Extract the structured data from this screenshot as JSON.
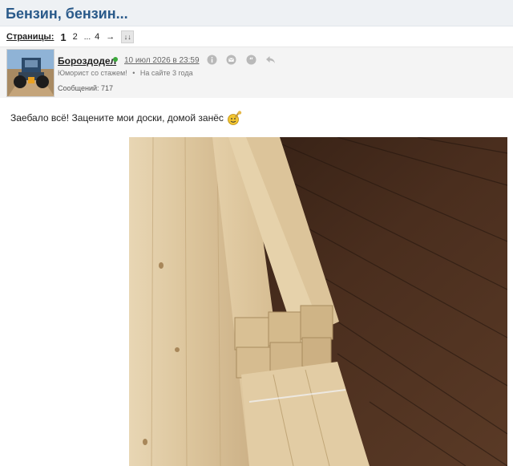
{
  "topic": {
    "title": "Бензин, бензин..."
  },
  "pager": {
    "label": "Страницы:",
    "pages": [
      "1",
      "2",
      "...",
      "4"
    ],
    "next_arrow": "→",
    "jump_label": "↓↓"
  },
  "post": {
    "author": "Бороздодел",
    "date": "10 июл 2026 в 23:59",
    "rank": "Юморист со стажем!",
    "separator": "•",
    "online_since": "На сайте 3 года",
    "posts_count": "Сообщений: 717",
    "text": "Заебало всё! Зацените мои доски, домой занёс",
    "action_icons": [
      "info-icon",
      "mail-icon",
      "quote-icon",
      "reply-icon"
    ]
  },
  "colors": {
    "title": "#2a5a8a",
    "header_bg": "#eef1f4",
    "post_header_bg": "#f4f4f4",
    "online": "#3aa83a",
    "icon": "#b9b9b9",
    "floor": "#3a2418",
    "wood": "#e0caa4"
  }
}
